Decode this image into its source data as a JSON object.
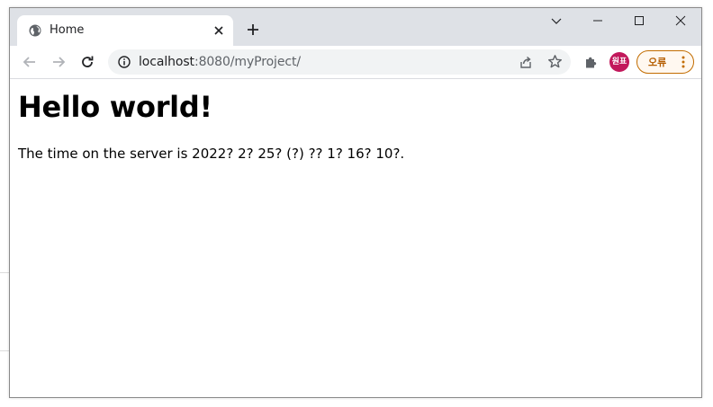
{
  "tab": {
    "title": "Home",
    "favicon": "globe-icon"
  },
  "window_controls": {
    "tab_search": "chevron-down-icon",
    "minimize": "minimize-icon",
    "maximize": "maximize-icon",
    "close": "close-icon"
  },
  "toolbar": {
    "back_icon": "arrow-left-icon",
    "forward_icon": "arrow-right-icon",
    "reload_icon": "reload-icon",
    "url_host": "localhost",
    "url_rest": ":8080/myProject/",
    "profile_initials": "원표",
    "profile_color": "#c2185b",
    "error_label": "오류",
    "error_color": "#b55d00"
  },
  "page": {
    "heading": "Hello world!",
    "server_time_text": "The time on the server is 2022? 2? 25? (?) ?? 1? 16? 10?."
  }
}
